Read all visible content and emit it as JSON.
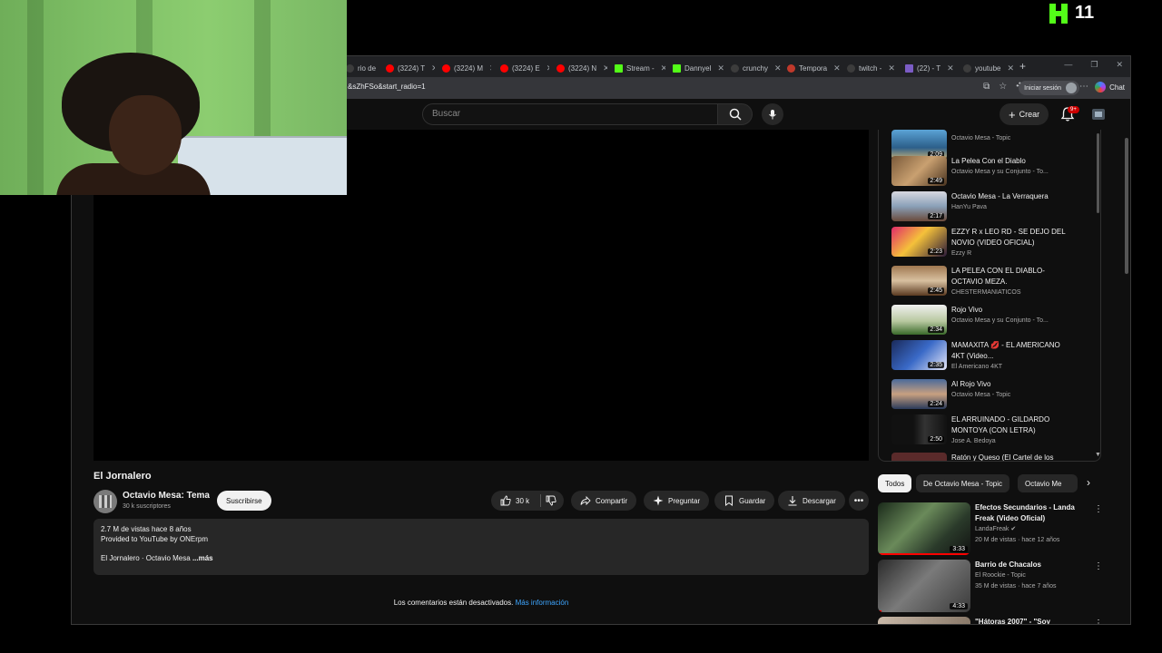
{
  "overlay": {
    "kick_count": "11"
  },
  "browser": {
    "tabs": [
      {
        "label": "rio de",
        "color": "#3c3c3c"
      },
      {
        "label": "(3224) T",
        "color": "#ff0000"
      },
      {
        "label": "(3224) M",
        "color": "#ff0000"
      },
      {
        "label": "(3224) E",
        "color": "#ff0000"
      },
      {
        "label": "(3224) N",
        "color": "#ff0000"
      },
      {
        "label": "Stream -",
        "color": "#53fc18"
      },
      {
        "label": "Dannyel",
        "color": "#53fc18"
      },
      {
        "label": "crunchy",
        "color": "#3c3c3c"
      },
      {
        "label": "Tempora",
        "color": "#c0392b"
      },
      {
        "label": "twitch -",
        "color": "#3c3c3c"
      },
      {
        "label": "(22) - T",
        "color": "#7b5cc4"
      },
      {
        "label": "youtube",
        "color": "#3c3c3c"
      }
    ],
    "url": "&sZhFSo&start_radio=1",
    "signin_label": "Iniciar sesión",
    "chat_label": "Chat"
  },
  "header": {
    "search_placeholder": "Buscar",
    "create_label": "Crear",
    "notif_badge": "9+"
  },
  "video": {
    "title": "El Jornalero",
    "channel": "Octavio Mesa: Tema",
    "subscribers": "30 k suscriptores",
    "subscribe_label": "Suscribirse",
    "likes": "30 k",
    "share_label": "Compartir",
    "ask_label": "Preguntar",
    "save_label": "Guardar",
    "download_label": "Descargar",
    "description": {
      "stats": "2.7 M de vistas  hace 8 años",
      "provided": "Provided to YouTube by ONErpm",
      "snippet": "El Jornalero · Octavio Mesa",
      "more": "...más"
    },
    "comments_off": "Los comentarios están desactivados.",
    "more_info": "Más información"
  },
  "playlist": [
    {
      "title": "",
      "channel": "Octavio Mesa - Topic",
      "duration": "2:09"
    },
    {
      "title": "La Pelea Con el Diablo",
      "channel": "Octavio Mesa y su Conjunto - To...",
      "duration": "2:49"
    },
    {
      "title": "Octavio Mesa - La Verraquera",
      "channel": "HanYu Pava",
      "duration": "2:17"
    },
    {
      "title": "EZZY R x LEO RD - SE DEJO DEL NOVIO (VIDEO OFICIAL)",
      "channel": "Ezzy R",
      "duration": "2:23"
    },
    {
      "title": "LA PELEA CON EL DIABLO- OCTAVIO MEZA.",
      "channel": "CHESTERMANIATICOS",
      "duration": "2:45"
    },
    {
      "title": "Rojo Vivo",
      "channel": "Octavio Mesa y su Conjunto - To...",
      "duration": "2:34"
    },
    {
      "title": "MAMAXITA 💋 - EL AMERICANO 4KT (Video...",
      "channel": "El Americano 4KT",
      "duration": "2:35"
    },
    {
      "title": "Al Rojo Vivo",
      "channel": "Octavio Mesa - Topic",
      "duration": "2:24"
    },
    {
      "title": "EL ARRUINADO - GILDARDO MONTOYA (CON LETRA)",
      "channel": "Jose A. Bedoya",
      "duration": "2:50"
    },
    {
      "title": "Ratón y Queso (El Cartel de los",
      "channel": "",
      "duration": ""
    }
  ],
  "chips": [
    "Todos",
    "De Octavio Mesa - Topic",
    "Octavio Me"
  ],
  "recommendations": [
    {
      "title": "Efectos Secundarios - Landa Freak (Video Oficial)",
      "channel": "LandaFreak",
      "meta": "20 M de vistas · hace 12 años",
      "duration": "3:33"
    },
    {
      "title": "Barrio de Chacalos",
      "channel": "El Roockie - Topic",
      "meta": "35 M de vistas · hace 7 años",
      "duration": "4:33"
    },
    {
      "title": "\"Hátoras 2007\" - \"Soy",
      "channel": "",
      "meta": "",
      "duration": ""
    }
  ],
  "colors": {
    "accent": "#3ea6ff",
    "kick": "#53fc18",
    "yt_red": "#ff0000"
  }
}
